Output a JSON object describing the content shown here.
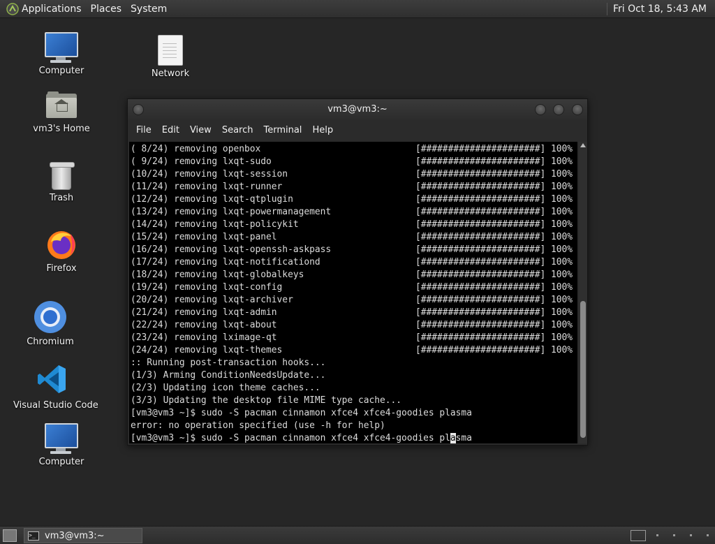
{
  "top_panel": {
    "menus": [
      "Applications",
      "Places",
      "System"
    ],
    "clock": "Fri Oct 18,  5:43 AM"
  },
  "desktop_icons": [
    {
      "label": "Computer",
      "icon": "computer-icon"
    },
    {
      "label": "Network",
      "icon": "network-icon"
    },
    {
      "label": "vm3's Home",
      "icon": "home-folder-icon"
    },
    {
      "label": "Trash",
      "icon": "trash-icon"
    },
    {
      "label": "Firefox",
      "icon": "firefox-icon"
    },
    {
      "label": "Chromium",
      "icon": "chromium-icon"
    },
    {
      "label": "Visual Studio Code",
      "icon": "vscode-icon"
    },
    {
      "label": "Computer",
      "icon": "computer-icon"
    }
  ],
  "terminal": {
    "title": "vm3@vm3:~",
    "menu": [
      "File",
      "Edit",
      "View",
      "Search",
      "Terminal",
      "Help"
    ],
    "progress_bar": "[######################]",
    "progress_pct": "100%",
    "removals": [
      {
        "step": "( 8/24)",
        "pkg": "openbox"
      },
      {
        "step": "( 9/24)",
        "pkg": "lxqt-sudo"
      },
      {
        "step": "(10/24)",
        "pkg": "lxqt-session"
      },
      {
        "step": "(11/24)",
        "pkg": "lxqt-runner"
      },
      {
        "step": "(12/24)",
        "pkg": "lxqt-qtplugin"
      },
      {
        "step": "(13/24)",
        "pkg": "lxqt-powermanagement"
      },
      {
        "step": "(14/24)",
        "pkg": "lxqt-policykit"
      },
      {
        "step": "(15/24)",
        "pkg": "lxqt-panel"
      },
      {
        "step": "(16/24)",
        "pkg": "lxqt-openssh-askpass"
      },
      {
        "step": "(17/24)",
        "pkg": "lxqt-notificationd"
      },
      {
        "step": "(18/24)",
        "pkg": "lxqt-globalkeys"
      },
      {
        "step": "(19/24)",
        "pkg": "lxqt-config"
      },
      {
        "step": "(20/24)",
        "pkg": "lxqt-archiver"
      },
      {
        "step": "(21/24)",
        "pkg": "lxqt-admin"
      },
      {
        "step": "(22/24)",
        "pkg": "lxqt-about"
      },
      {
        "step": "(23/24)",
        "pkg": "lximage-qt"
      },
      {
        "step": "(24/24)",
        "pkg": "lxqt-themes"
      }
    ],
    "removing_word": "removing",
    "after_lines": [
      ":: Running post-transaction hooks...",
      "(1/3) Arming ConditionNeedsUpdate...",
      "(2/3) Updating icon theme caches...",
      "(3/3) Updating the desktop file MIME type cache...",
      "[vm3@vm3 ~]$ sudo -S pacman cinnamon xfce4 xfce4-goodies plasma",
      "error: no operation specified (use -h for help)"
    ],
    "prompt_before_cursor": "[vm3@vm3 ~]$ sudo -S pacman cinnamon xfce4 xfce4-goodies pl",
    "prompt_cursor_char": "a",
    "prompt_after_cursor": "sma"
  },
  "taskbar": {
    "window_button": "vm3@vm3:~"
  }
}
